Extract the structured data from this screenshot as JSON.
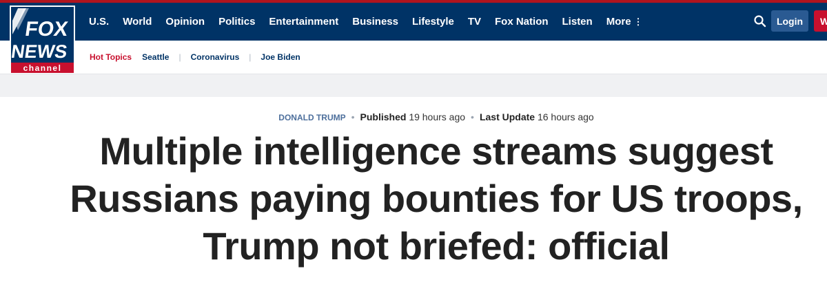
{
  "logo": {
    "line1": "FOX",
    "line2": "NEWS",
    "line3": "channel"
  },
  "nav": {
    "items": [
      "U.S.",
      "World",
      "Opinion",
      "Politics",
      "Entertainment",
      "Business",
      "Lifestyle",
      "TV",
      "Fox Nation",
      "Listen"
    ],
    "more_label": "More",
    "more_icon": "⋮",
    "login_label": "Login",
    "watch_label": "W"
  },
  "subnav": {
    "hot_topics_label": "Hot Topics",
    "topics": [
      "Seattle",
      "Coronavirus",
      "Joe Biden"
    ]
  },
  "article": {
    "category": "DONALD TRUMP",
    "published_label": "Published",
    "published_time": "19 hours ago",
    "updated_label": "Last Update",
    "updated_time": "16 hours ago",
    "headline": "Multiple intelligence streams suggest Russians paying bounties for US troops, Trump not briefed: official"
  },
  "colors": {
    "nav_bg": "#003366",
    "accent_red": "#c8102e",
    "login_bg": "#2a5a92",
    "category_link": "#4d6f9c"
  },
  "icons": [
    "search-icon",
    "more-dots-icon",
    "fox-news-logo"
  ]
}
